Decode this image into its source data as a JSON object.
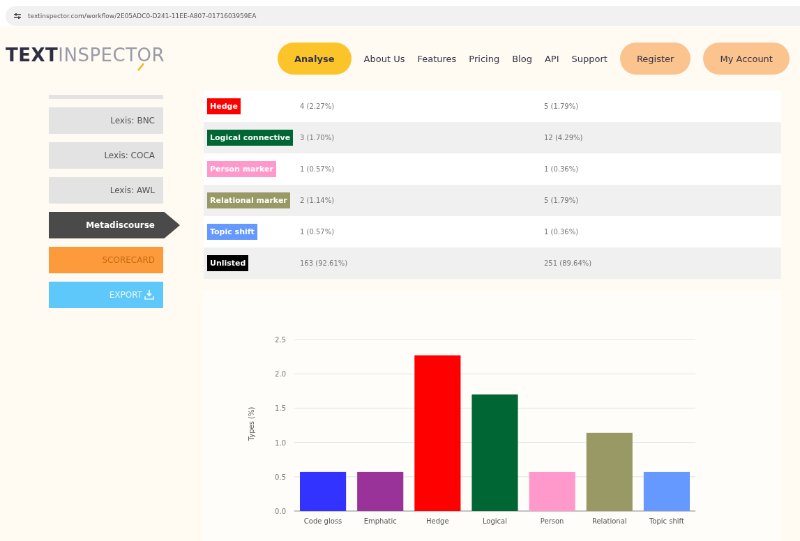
{
  "address_bar": {
    "url": "textinspector.com/workflow/2E05ADC0-D241-11EE-A807-0171603959EA"
  },
  "logo": {
    "bold": "TEXT",
    "light": "INSPECT",
    "ring": "O",
    "end": "R"
  },
  "nav": [
    {
      "label": "Analyse",
      "kind": "pill",
      "selected": true
    },
    {
      "label": "About Us",
      "kind": "link",
      "selected": false
    },
    {
      "label": "Features",
      "kind": "link",
      "selected": false
    },
    {
      "label": "Pricing",
      "kind": "link",
      "selected": false
    },
    {
      "label": "Blog",
      "kind": "link",
      "selected": false
    },
    {
      "label": "API",
      "kind": "link",
      "selected": false
    },
    {
      "label": "Support",
      "kind": "link",
      "selected": false
    },
    {
      "label": "Register",
      "kind": "account",
      "selected": false
    },
    {
      "label": "My Account",
      "kind": "account",
      "selected": false
    }
  ],
  "sidebar": [
    {
      "kind": "cut"
    },
    {
      "label": "Lexis: BNC",
      "kind": "plain",
      "selected": false
    },
    {
      "label": "Lexis: COCA",
      "kind": "plain",
      "selected": false
    },
    {
      "label": "Lexis: AWL",
      "kind": "plain",
      "selected": false
    },
    {
      "label": "Metadiscourse",
      "kind": "plain",
      "selected": true
    },
    {
      "label": "SCORECARD",
      "kind": "scorecard",
      "selected": false
    },
    {
      "label": "EXPORT",
      "kind": "export",
      "selected": false
    }
  ],
  "table": {
    "rows": [
      {
        "tag": "Hedge",
        "color": "#ff0000",
        "types": "4 (2.27%)",
        "tokens": "5 (1.79%)"
      },
      {
        "tag": "Logical connective",
        "color": "#006633",
        "types": "3 (1.70%)",
        "tokens": "12 (4.29%)"
      },
      {
        "tag": "Person marker",
        "color": "#ff99cc",
        "types": "1 (0.57%)",
        "tokens": "1 (0.36%)"
      },
      {
        "tag": "Relational marker",
        "color": "#999966",
        "types": "2 (1.14%)",
        "tokens": "5 (1.79%)"
      },
      {
        "tag": "Topic shift",
        "color": "#6699ff",
        "types": "1 (0.57%)",
        "tokens": "1 (0.36%)"
      },
      {
        "tag": "Unlisted",
        "color": "#000000",
        "types": "163 (92.61%)",
        "tokens": "251 (89.64%)"
      }
    ]
  },
  "chart": {
    "chart_data": {
      "type": "bar",
      "ylabel": "Types (%)",
      "categories": [
        "Code gloss",
        "Emphatic",
        "Hedge",
        "Logical",
        "Person",
        "Relational",
        "Topic shift"
      ],
      "series": [
        {
          "color": "#3333ff",
          "values": [
            0.57,
            null,
            null,
            null,
            null,
            null,
            null
          ]
        },
        {
          "color": "#993399",
          "values": [
            null,
            0.57,
            null,
            null,
            null,
            null,
            null
          ]
        },
        {
          "color": "#ff0000",
          "values": [
            null,
            null,
            2.27,
            null,
            null,
            null,
            null
          ]
        },
        {
          "color": "#006633",
          "values": [
            null,
            null,
            null,
            1.7,
            null,
            null,
            null
          ]
        },
        {
          "color": "#ff99cc",
          "values": [
            null,
            null,
            null,
            null,
            0.57,
            null,
            null
          ]
        },
        {
          "color": "#999966",
          "values": [
            null,
            null,
            null,
            null,
            null,
            1.14,
            null
          ]
        },
        {
          "color": "#6699ff",
          "values": [
            null,
            null,
            null,
            null,
            null,
            null,
            0.57
          ]
        }
      ],
      "stacked": true,
      "grid": true,
      "ylim": [
        0,
        2.5
      ],
      "yticks": [
        {
          "value": 0,
          "label": "0.0"
        },
        {
          "value": 0.5,
          "label": "0.5"
        },
        {
          "value": 1,
          "label": "1.0"
        },
        {
          "value": 1.5,
          "label": "1.5"
        },
        {
          "value": 2,
          "label": "2.0"
        },
        {
          "value": 2.5,
          "label": "2.5"
        }
      ]
    }
  }
}
